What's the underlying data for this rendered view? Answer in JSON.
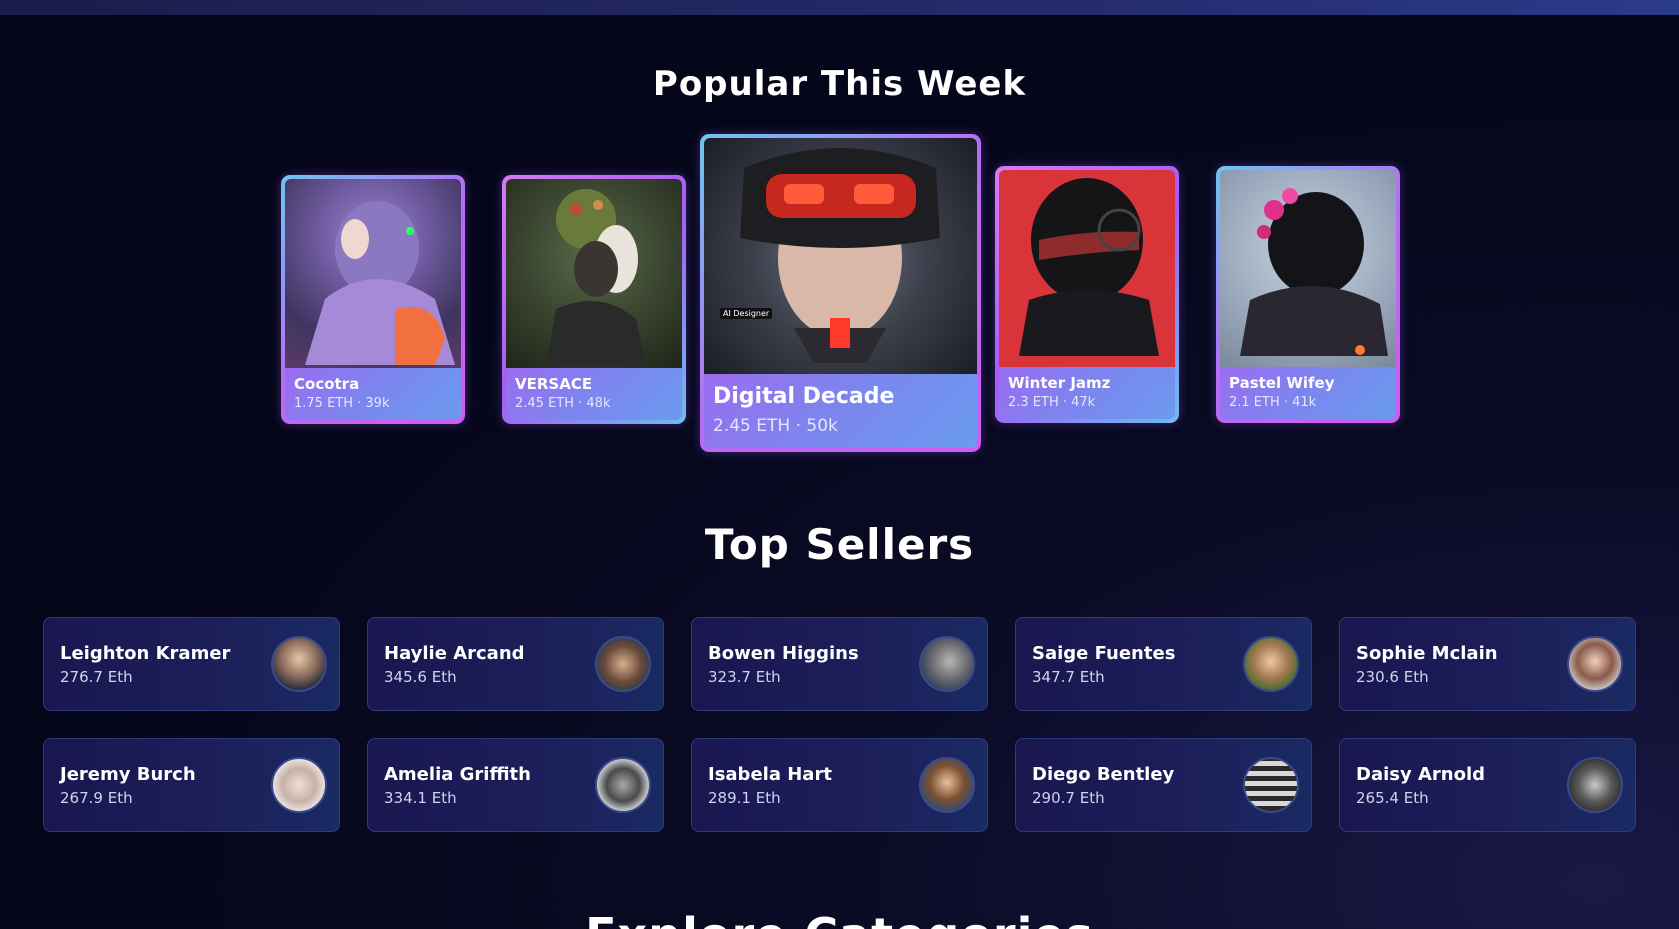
{
  "sections": {
    "popular_title": "Popular This Week",
    "sellers_title": "Top Sellers",
    "next_title": "Explore Categories"
  },
  "popular": [
    {
      "name": "Cocotra",
      "meta": "1.75 ETH · 39k"
    },
    {
      "name": "VERSACE",
      "meta": "2.45 ETH · 48k"
    },
    {
      "name": "Digital Decade",
      "meta": "2.45 ETH · 50k",
      "badge": "AI Designer"
    },
    {
      "name": "Winter Jamz",
      "meta": "2.3 ETH · 47k"
    },
    {
      "name": "Pastel Wifey",
      "meta": "2.1 ETH · 41k"
    }
  ],
  "sellers": [
    {
      "name": "Leighton Kramer",
      "volume": "276.7 Eth"
    },
    {
      "name": "Haylie Arcand",
      "volume": "345.6 Eth"
    },
    {
      "name": "Bowen Higgins",
      "volume": "323.7 Eth"
    },
    {
      "name": "Saige Fuentes",
      "volume": "347.7 Eth"
    },
    {
      "name": "Sophie Mclain",
      "volume": "230.6 Eth"
    },
    {
      "name": "Jeremy Burch",
      "volume": "267.9 Eth"
    },
    {
      "name": "Amelia Griffith",
      "volume": "334.1 Eth"
    },
    {
      "name": "Isabela Hart",
      "volume": "289.1 Eth"
    },
    {
      "name": "Diego Bentley",
      "volume": "290.7 Eth"
    },
    {
      "name": "Daisy Arnold",
      "volume": "265.4 Eth"
    }
  ],
  "colors": {
    "background": "#07071b",
    "card_gradient_start": "#6ec5f0",
    "card_gradient_end": "#d05cf2",
    "seller_card": "#1a1650"
  }
}
